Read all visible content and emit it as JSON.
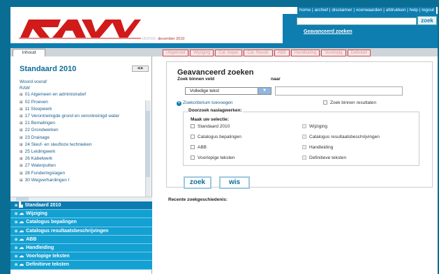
{
  "header": {
    "logo_text": "RAW",
    "version_label": "VERSIE:",
    "version_value": "december 2010",
    "top_nav": [
      "home",
      "archief",
      "disclaimer",
      "voorwaarden",
      "afdrukken",
      "help",
      "logout"
    ],
    "search_button": "zoek",
    "advanced_link": "Geavanceerd zoeken"
  },
  "tabs": {
    "active": "Inhoud",
    "disabled": [
      "Uitgebreid",
      "Wijziging",
      "Cat. bepal.",
      "Cat. Result.",
      "ABB",
      "Handleiding",
      "Voorlopig",
      "Definitief"
    ]
  },
  "sidebar": {
    "title": "Standaard 2010",
    "tree_top": [
      "Woord vooraf",
      "RAW"
    ],
    "tree": [
      {
        "num": "01",
        "label": "01 Algemeen en administratief"
      },
      {
        "num": "02",
        "label": "02 Proeven"
      },
      {
        "num": "11",
        "label": "11 Sloopwerk"
      },
      {
        "num": "17",
        "label": "17 Verontreinigde grond en verontreinigd water"
      },
      {
        "num": "21",
        "label": "21 Bemalingen"
      },
      {
        "num": "22",
        "label": "22 Grondwerken"
      },
      {
        "num": "23",
        "label": "23 Drainage"
      },
      {
        "num": "24",
        "label": "24 Sleuf- en sleufloze technieken"
      },
      {
        "num": "25",
        "label": "25 Leidingwerk"
      },
      {
        "num": "26",
        "label": "26 Kabelwerk"
      },
      {
        "num": "27",
        "label": "27 Waterputten"
      },
      {
        "num": "28",
        "label": "28 Funderingslagen"
      },
      {
        "num": "30",
        "label": "30 Wegverhardingen I"
      }
    ],
    "accordion": [
      "Standaard 2010",
      "Wijziging",
      "Catalogus bepalingen",
      "Catalogus resultaatsbeschrijvingen",
      "ABB",
      "Handleiding",
      "Voorlopige teksten",
      "Definitieve teksten"
    ]
  },
  "search": {
    "title": "Geavanceerd zoeken",
    "field_label": "Zoek binnen veld",
    "target_label": "naar",
    "field_value": "Volledige tekst",
    "target_value": "",
    "add_criterion": "Zoekcriterium toevoegen",
    "within_results": "Zoek binnen resultaten",
    "group_title": "Doorzoek naslagwerken:",
    "group_subtitle": "Maak uw selectie:",
    "left_options": [
      "Standaard 2010",
      "Catalogus bepalingen",
      "ABB",
      "Voorlopige teksten"
    ],
    "right_options": [
      "Wijziging",
      "Catalogus resultaatsbeschrijvingen",
      "Handleiding",
      "Definitieve teksten"
    ],
    "btn_search": "zoek",
    "btn_clear": "wis",
    "history_title": "Recente zoekgeschiedenis:"
  },
  "colors": {
    "brand_red": "#d11a1a",
    "teal": "#0e7db0",
    "accordion": "#13a0d2"
  }
}
